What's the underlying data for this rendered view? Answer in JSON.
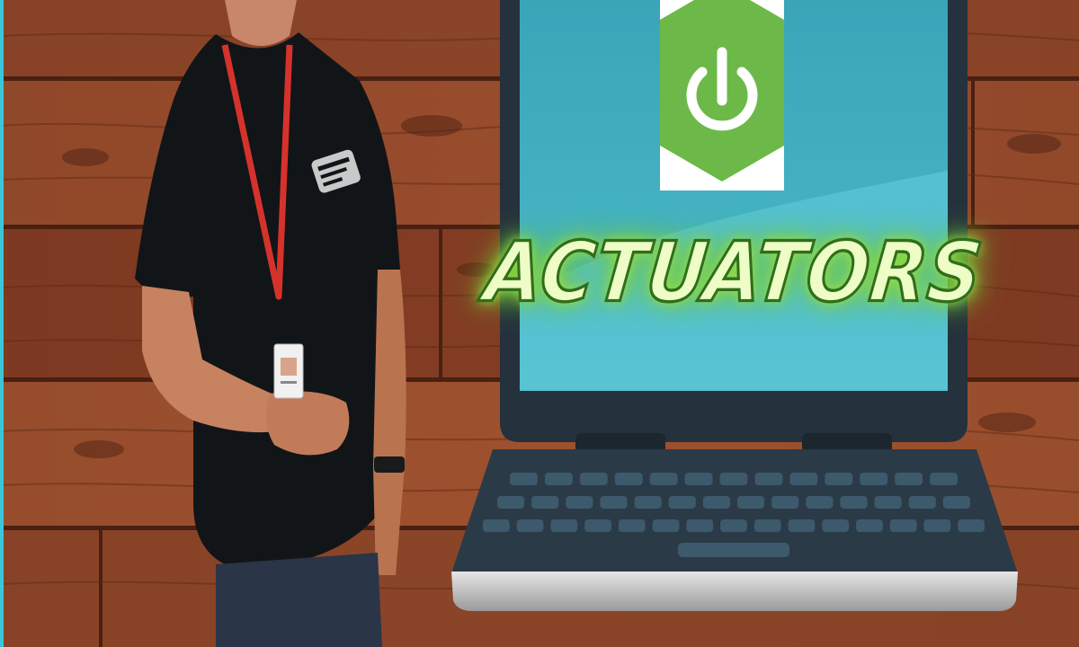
{
  "headline": "ACTUATORS",
  "icons": {
    "logo": "power-icon"
  },
  "colors": {
    "wood_dark": "#5a2a18",
    "wood_mid": "#8a4428",
    "wood_light": "#a85a34",
    "screen_bezel": "#25313d",
    "screen_cyan": "#4ab2c6",
    "screen_wave": "#5bc6d6",
    "logo_green": "#6cb94a",
    "glow_green": "#9ee04a",
    "keyboard_key": "#3d5a6c",
    "keyboard_base": "#2b3a47"
  }
}
